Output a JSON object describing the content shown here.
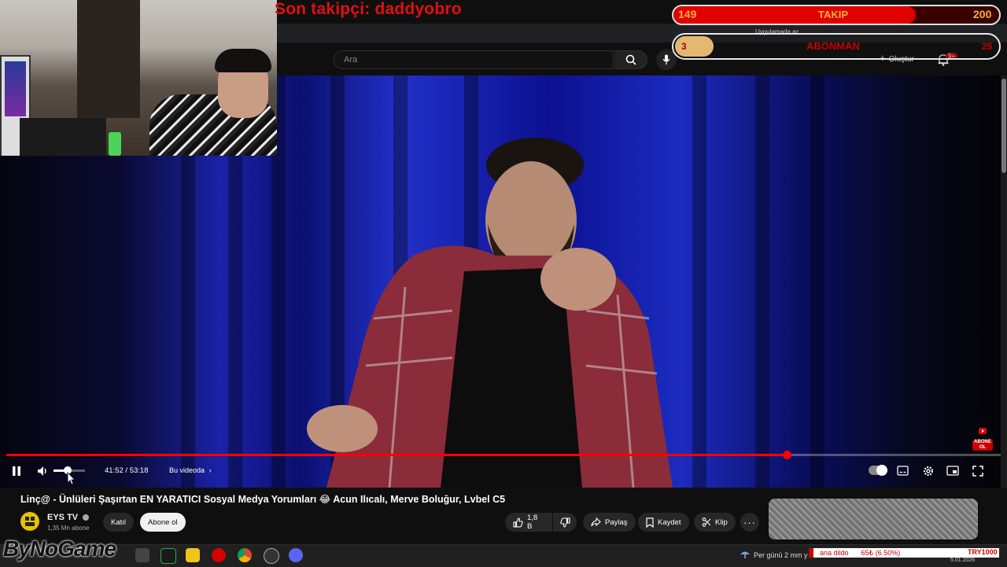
{
  "overlay": {
    "last_follower": "Son takipçi: daddyobro",
    "follow_goal": {
      "current": "149",
      "label": "TAKIP",
      "target": "200",
      "progress": 0.745
    },
    "sub_goal": {
      "current": "3",
      "label": "ABONMAN",
      "target": "25",
      "progress": 0.12
    },
    "brand_watermark": "ByNoGame",
    "subscribe_badge": "ABONE OL"
  },
  "browser": {
    "open_in_app": "Uygulamada aç"
  },
  "header": {
    "search_placeholder": "Ara",
    "create_label": "Oluştur",
    "notification_count": "9+"
  },
  "player": {
    "time_current": "41:52",
    "time_separator": "/",
    "time_total": "53:18",
    "chapter_label": "Bu videoda",
    "progress": 0.785,
    "volume": 0.45
  },
  "video": {
    "title": "Linç@ - Ünlüleri Şaşırtan EN YARATICI Sosyal Medya Yorumları 😂 Acun Ilıcalı, Merve Boluğur, Lvbel C5"
  },
  "channel": {
    "name": "EYS TV",
    "subscribers": "1,35 Mn abone",
    "join_label": "Katıl",
    "subscribe_label": "Abone ol"
  },
  "actions": {
    "like_count": "1,8 B",
    "share_label": "Paylaş",
    "save_label": "Kaydet",
    "clip_label": "Klip"
  },
  "taskbar": {
    "weather_text": "Per günü 2 mm y",
    "ticker_text": "ana dildo",
    "ticker_value": "65₺ (6.50%)",
    "ticker_currency": "TRY1000",
    "date": "5.01.2026"
  },
  "colors": {
    "accent_red": "#ff0000",
    "overlay_red": "#e01010",
    "sub_gold": "#e3b870"
  }
}
